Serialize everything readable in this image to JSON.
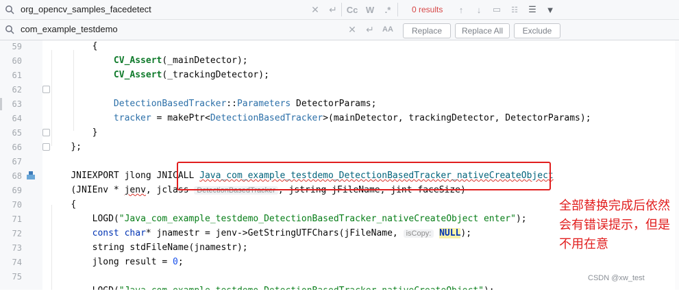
{
  "find": {
    "search_value": "org_opencv_samples_facedetect",
    "results_text": "0 results",
    "case_label": "Cc",
    "words_label": "W",
    "regex_label": ".*"
  },
  "replace": {
    "replace_value": "com_example_testdemo",
    "replace_label": "Replace",
    "replace_all_label": "Replace All",
    "exclude_label": "Exclude"
  },
  "gutter": {
    "line_numbers": [
      "59",
      "60",
      "61",
      "62",
      "63",
      "64",
      "65",
      "66",
      "67",
      "68",
      "69",
      "70",
      "71",
      "72",
      "73",
      "74",
      "75"
    ]
  },
  "code": {
    "l59": "{",
    "l60_call": "CV_Assert",
    "l60_arg": "(_mainDetector);",
    "l61_call": "CV_Assert",
    "l61_arg": "(_trackingDetector);",
    "l63_type": "DetectionBasedTracker",
    "l63_sep": "::",
    "l63_param": "Parameters",
    "l63_rest": " DetectorParams;",
    "l64_var": "tracker",
    "l64_eq": " = ",
    "l64_fn": "makePtr",
    "l64_lt": "<",
    "l64_type": "DetectionBasedTracker",
    "l64_rest": ">(mainDetector, trackingDetector, DetectorParams);",
    "l65": "}",
    "l66": "};",
    "l68_prefix": "JNIEXPORT jlong JNICALL ",
    "l68_fn": "Java_com_example_testdemo_DetectionBasedTracker_nativeCreateObject",
    "l69_a": "(JNIEnv * ",
    "l69_jenv": "jenv",
    "l69_b": ", jclass ",
    "l69_hint": "DetectionBasedTracker",
    "l69_c": ", jstring jFileName, jint faceSize)",
    "l70": "{",
    "l71_fn": "LOGD",
    "l71_str": "\"Java_com_example_testdemo_DetectionBasedTracker_nativeCreateObject enter\"",
    "l71_end": ");",
    "l72_kw1": "const",
    "l72_kw2": "char",
    "l72_mid": "* jnamestr = jenv->GetStringUTFChars(jFileName, ",
    "l72_hint": "isCopy:",
    "l72_null": "NULL",
    "l72_end": ");",
    "l73": "string stdFileName(jnamestr);",
    "l74_a": "jlong result = ",
    "l74_num": "0",
    "l74_b": ";",
    "l76_fn": "LOGD",
    "l76_str": "\"Java_com_example_testdemo_DetectionBasedTracker_nativeCreateObject\"",
    "l76_end": ");"
  },
  "annotation": {
    "note": "全部替换完成后依然会有错误提示，但是不用在意",
    "color": "#e11e1e"
  },
  "watermark": "CSDN @xw_test"
}
